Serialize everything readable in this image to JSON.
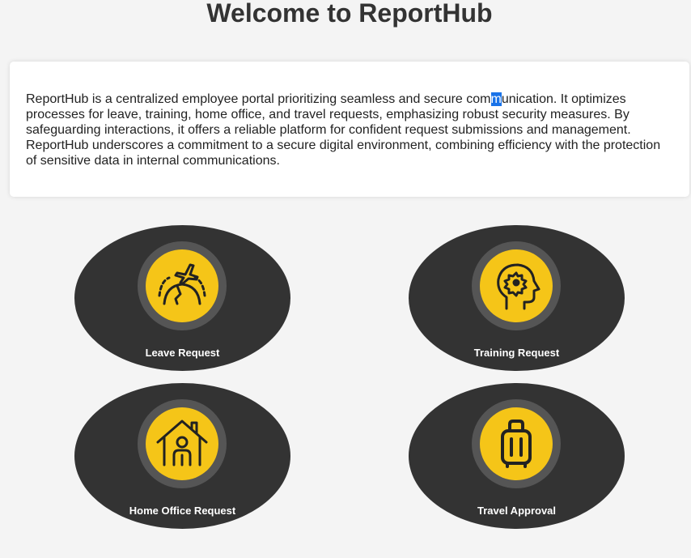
{
  "page": {
    "title": "Welcome to ReportHub"
  },
  "intro": {
    "line1_before": "ReportHub is a centralized employee portal prioritizing seamless and secure com",
    "line1_highlight": "m",
    "line1_after": "unication. It optimizes\nprocesses for leave, training, home office, and travel requests, emphasizing robust security measures. By\nsafeguarding interactions, it offers a reliable platform for confident request submissions and management.\nReportHub underscores a commitment to a secure digital environment, combining efficiency with the protection\nof sensitive data in internal communications."
  },
  "colors": {
    "background": "#f4f4f4",
    "tile": "#333333",
    "ring": "#555555",
    "accent": "#f5c518"
  },
  "tiles": [
    {
      "label": "Leave Request",
      "icon": "plane-over-globe-icon"
    },
    {
      "label": "Training Request",
      "icon": "head-with-gear-icon"
    },
    {
      "label": "Home Office Request",
      "icon": "house-with-person-icon"
    },
    {
      "label": "Travel Approval",
      "icon": "luggage-icon"
    }
  ]
}
